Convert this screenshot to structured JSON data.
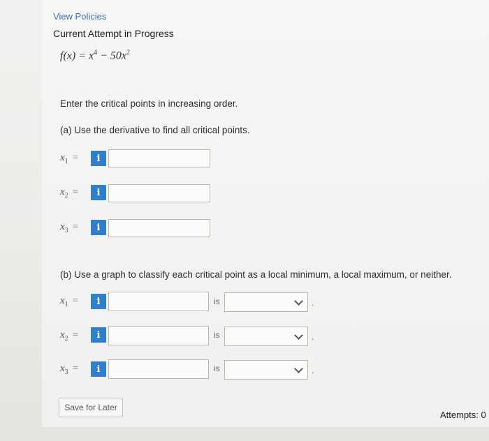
{
  "header": {
    "view_policies": "View Policies",
    "attempt_title": "Current Attempt in Progress"
  },
  "problem": {
    "formula_lhs": "f(x) = x",
    "formula_exp1": "4",
    "formula_mid": " − 50x",
    "formula_exp2": "2",
    "instruction": "Enter the critical points in increasing order.",
    "part_a": "(a) Use the derivative to find all critical points.",
    "part_b": "(b) Use a graph to classify each critical point as a local minimum, a local maximum, or neither."
  },
  "vars": {
    "x": "x",
    "sub1": "1",
    "sub2": "2",
    "sub3": "3",
    "equals": "="
  },
  "info_icon_label": "i",
  "answers_a": [
    "",
    "",
    ""
  ],
  "answers_b": [
    "",
    "",
    ""
  ],
  "is_label": "is",
  "classify_selected": [
    "",
    "",
    ""
  ],
  "trailing_dot": ".",
  "footer": {
    "save_button": "Save for Later",
    "attempts": "Attempts: 0"
  },
  "colors": {
    "accent": "#2f7fd0",
    "link": "#3a6fb3"
  }
}
